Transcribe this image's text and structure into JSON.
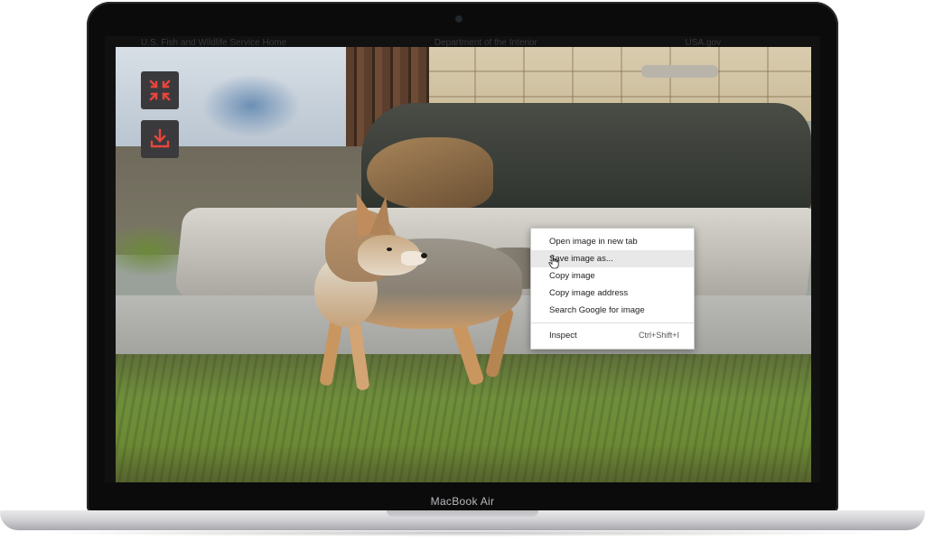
{
  "device": {
    "model_label": "MacBook Air"
  },
  "website_nav": {
    "links": [
      "U.S. Fish and Wildlife Service Home",
      "Department of the Interior",
      "USA.gov"
    ]
  },
  "overlay_buttons": {
    "exit_fullscreen_icon": "compress-arrows-icon",
    "download_icon": "download-tray-icon",
    "accent_color": "#e8453c"
  },
  "context_menu": {
    "items": [
      {
        "label": "Open image in new tab",
        "shortcut": ""
      },
      {
        "label": "Save image as...",
        "shortcut": "",
        "hovered": true
      },
      {
        "label": "Copy image",
        "shortcut": ""
      },
      {
        "label": "Copy image address",
        "shortcut": ""
      },
      {
        "label": "Search Google for image",
        "shortcut": ""
      },
      {
        "label": "Inspect",
        "shortcut": "Ctrl+Shift+I"
      }
    ]
  }
}
